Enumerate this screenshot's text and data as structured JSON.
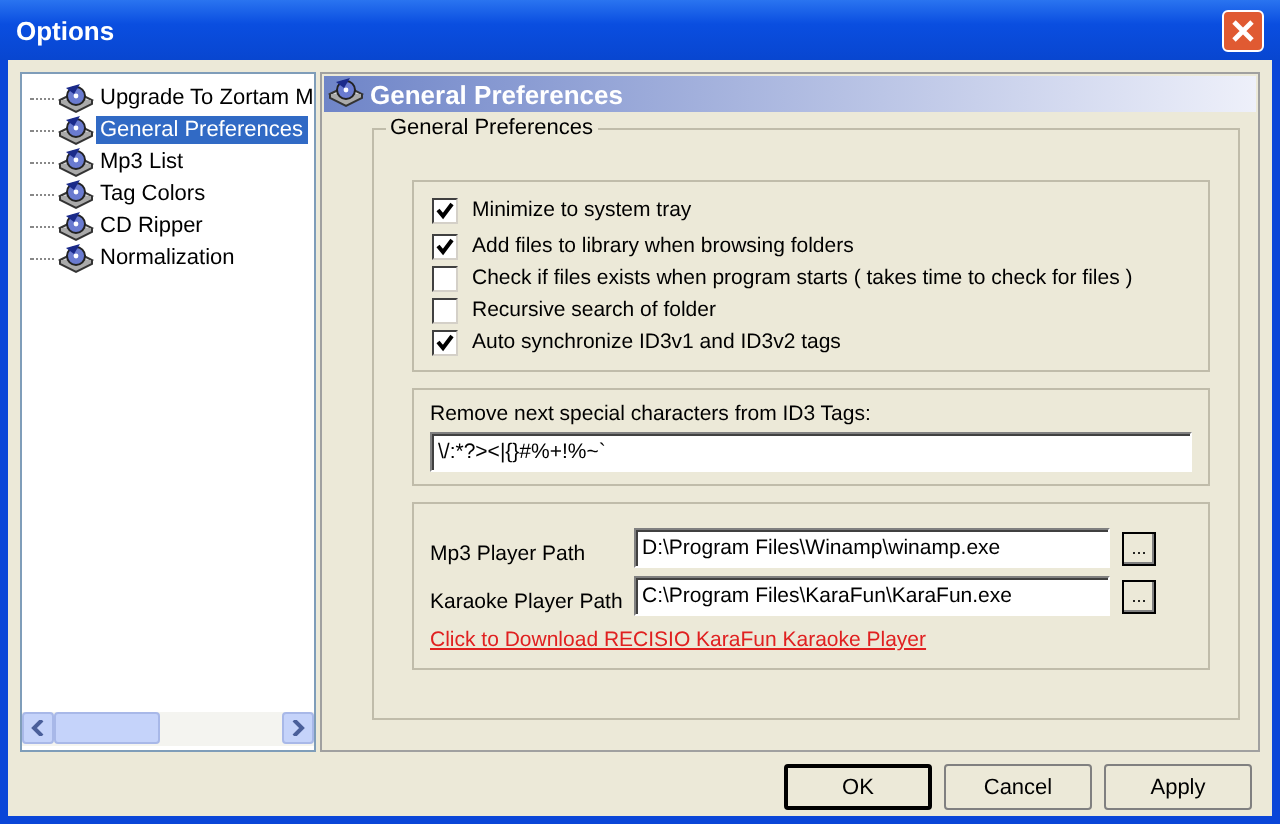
{
  "window": {
    "title": "Options"
  },
  "sidebar": {
    "items": [
      {
        "label": "Upgrade To Zortam M",
        "selected": false
      },
      {
        "label": "General Preferences",
        "selected": true
      },
      {
        "label": "Mp3 List",
        "selected": false
      },
      {
        "label": "Tag Colors",
        "selected": false
      },
      {
        "label": "CD Ripper",
        "selected": false
      },
      {
        "label": "Normalization",
        "selected": false
      }
    ]
  },
  "panel": {
    "header": "General Preferences",
    "group_title": "General Preferences",
    "options": [
      {
        "label": "Minimize to system tray",
        "checked": true
      },
      {
        "label": "Add files to library when browsing folders",
        "checked": true
      },
      {
        "label": "Check if files exists when program starts ( takes time to check for files )",
        "checked": false
      },
      {
        "label": "Recursive search of folder",
        "checked": false
      },
      {
        "label": "Auto synchronize ID3v1 and ID3v2 tags",
        "checked": true
      }
    ],
    "special_chars": {
      "label": "Remove next special characters from ID3 Tags:",
      "value": "\\/:*?><|{}#%+!%~`"
    },
    "paths": [
      {
        "label": "Mp3 Player Path",
        "value": "D:\\Program Files\\Winamp\\winamp.exe",
        "browse": "..."
      },
      {
        "label": "Karaoke Player Path",
        "value": "C:\\Program Files\\KaraFun\\KaraFun.exe",
        "browse": "..."
      }
    ],
    "link": "Click to Download RECISIO KaraFun Karaoke Player"
  },
  "buttons": [
    {
      "label": "OK",
      "default": true
    },
    {
      "label": "Cancel",
      "default": false
    },
    {
      "label": "Apply",
      "default": false
    }
  ]
}
